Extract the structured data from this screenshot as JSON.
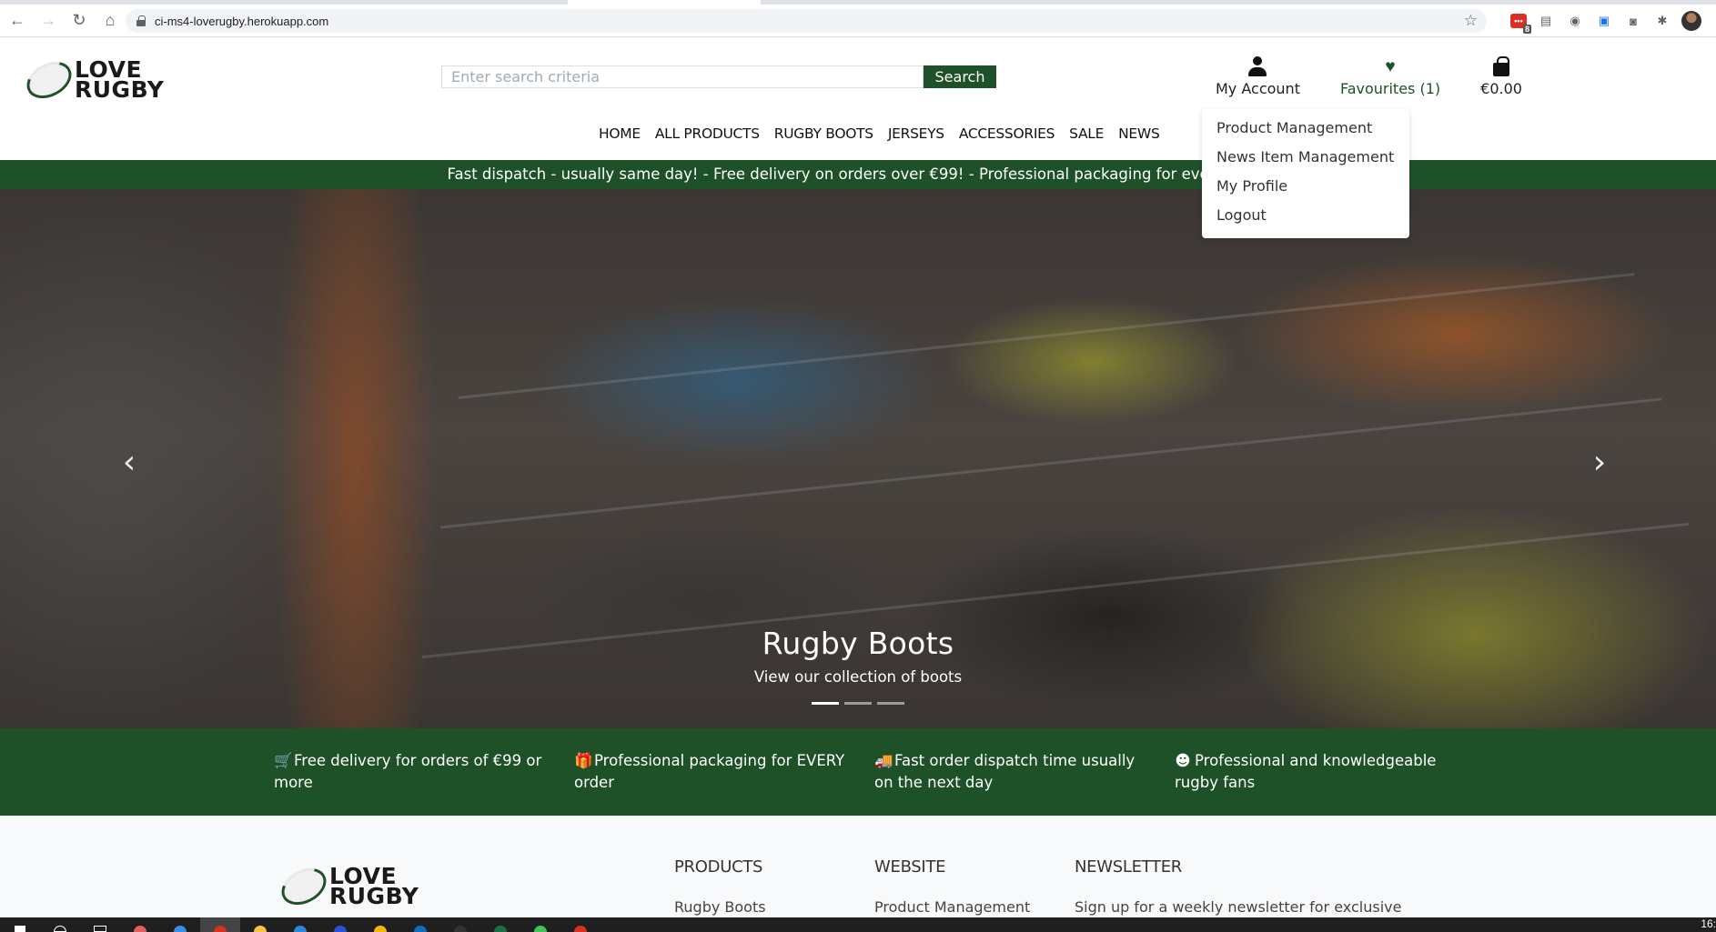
{
  "browser": {
    "url": "ci-ms4-loverugby.herokuapp.com",
    "extensions": [
      {
        "name": "lastpass-icon",
        "badge": "8"
      },
      {
        "name": "monitor-extension-icon"
      },
      {
        "name": "wappalyzer-icon"
      },
      {
        "name": "screen-recorder-icon"
      },
      {
        "name": "camera-icon"
      },
      {
        "name": "extensions-puzzle-icon"
      }
    ]
  },
  "header": {
    "logo": {
      "line1": "LOVE",
      "line2": "RUGBY"
    },
    "search": {
      "placeholder": "Enter search criteria",
      "value": "",
      "button_label": "Search"
    },
    "nav": [
      "HOME",
      "ALL PRODUCTS",
      "RUGBY BOOTS",
      "JERSEYS",
      "ACCESSORIES",
      "SALE",
      "NEWS"
    ],
    "account": {
      "label": "My Account",
      "icon": "user-icon"
    },
    "favourites": {
      "label": "Favourites (1)",
      "icon": "heart-icon"
    },
    "basket": {
      "label": "€0.00",
      "icon": "shopping-bag-icon"
    },
    "account_menu": [
      "Product Management",
      "News Item Management",
      "My Profile",
      "Logout"
    ]
  },
  "promo_banner": "Fast dispatch - usually same day! - Free delivery on orders over €99! - Professional packaging for every order",
  "carousel": {
    "title": "Rugby Boots",
    "subtitle": "View our collection of boots",
    "slide_count": 3,
    "active_slide": 1,
    "prev_label": "‹",
    "next_label": "›"
  },
  "features": [
    {
      "icon": "cart-plus-icon",
      "glyph": "🛒",
      "text": "Free delivery for orders of €99 or more"
    },
    {
      "icon": "gifts-icon",
      "glyph": "🎁",
      "text": "Professional packaging for EVERY order"
    },
    {
      "icon": "shipping-fast-icon",
      "glyph": "🚚",
      "text": "Fast order dispatch time usually on the next day"
    },
    {
      "icon": "smile-icon",
      "glyph": "☻",
      "text": "Professional and knowledgeable rugby fans"
    }
  ],
  "footer": {
    "logo": {
      "line1": "LOVE",
      "line2": "RUGBY"
    },
    "columns": [
      {
        "heading": "PRODUCTS",
        "first_item": "Rugby Boots"
      },
      {
        "heading": "WEBSITE",
        "first_item": "Product Management"
      },
      {
        "heading": "NEWSLETTER",
        "first_item": "Sign up for a weekly newsletter for exclusive"
      }
    ]
  },
  "taskbar": {
    "clock": "16:"
  },
  "colors": {
    "brand_green": "#1e5128"
  }
}
